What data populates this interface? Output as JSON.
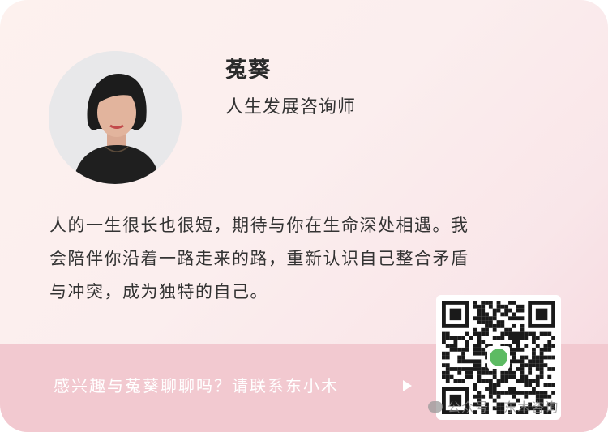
{
  "profile": {
    "name": "菟葵",
    "title": "人生发展咨询师",
    "bio_lines": [
      "人的一生很长也很短，期待与你在生命深处相遇。我",
      "会陪伴你沿着一路走来的路，重新认识自己整合矛盾",
      "与冲突，成为独特的自己。"
    ]
  },
  "cta": {
    "label": "感兴趣与菟葵聊聊吗？请联系东小木"
  },
  "watermark": {
    "label": "公众号 · 东木咨询",
    "icon": "wechat-icon"
  },
  "icons": {
    "cta": "play-triangle-icon",
    "qr": "qr-code"
  },
  "colors": {
    "card_bg": "#fbeeee",
    "cta_bar": "#f2c9d0",
    "text": "#333333",
    "qr_logo": "#5dbb63"
  }
}
